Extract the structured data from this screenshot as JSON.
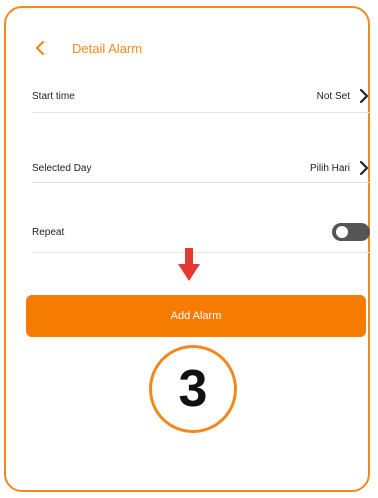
{
  "header": {
    "title": "Detail Alarm",
    "back_icon": "chevron-left-icon"
  },
  "rows": [
    {
      "label": "Start time",
      "value": "Not Set",
      "icon": "chevron-right-icon"
    },
    {
      "label": "Selected Day",
      "value": "Pilih Hari",
      "icon": "chevron-right-icon"
    },
    {
      "label": "Repeat",
      "toggle_on": false
    }
  ],
  "action": {
    "add_label": "Add Alarm",
    "pointer_icon": "arrow-down-icon"
  },
  "step_badge": "3",
  "colors": {
    "accent": "#f08a1c",
    "button": "#f57c00",
    "pointer_arrow": "#e53935",
    "toggle_off": "#555555"
  }
}
